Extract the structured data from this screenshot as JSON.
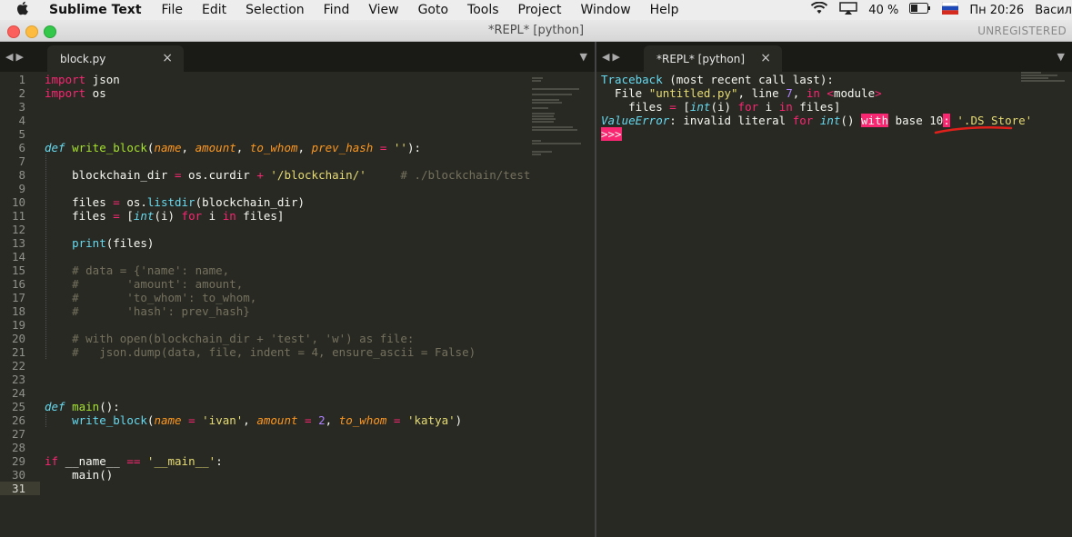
{
  "menubar": {
    "app": "Sublime Text",
    "menus": [
      "File",
      "Edit",
      "Selection",
      "Find",
      "View",
      "Goto",
      "Tools",
      "Project",
      "Window",
      "Help"
    ],
    "battery": "40 %",
    "clock": "Пн 20:26",
    "user": "Васил"
  },
  "window": {
    "title": "*REPL* [python]",
    "unregistered": "UNREGISTERED"
  },
  "left_tab": "block.py",
  "right_tab": "*REPL* [python]",
  "close_glyph": "×",
  "colors": {
    "keyword": "#f92672",
    "function": "#a6e22e",
    "builtin": "#66d9ef",
    "parameter": "#fd971f",
    "string": "#e6db74",
    "number": "#ae81ff",
    "comment": "#75715e",
    "background": "#282923",
    "annotation": "#e0201a"
  },
  "lines": [
    [
      [
        "import",
        "kw"
      ],
      [
        " json",
        ""
      ]
    ],
    [
      [
        "import",
        "kw"
      ],
      [
        " os",
        ""
      ]
    ],
    [],
    [],
    [],
    [
      [
        "def",
        "bii"
      ],
      [
        " ",
        ""
      ],
      [
        "write_block",
        "fn"
      ],
      [
        "(",
        ""
      ],
      [
        "name",
        "pa"
      ],
      [
        ", ",
        ""
      ],
      [
        "amount",
        "pa"
      ],
      [
        ", ",
        ""
      ],
      [
        "to_whom",
        "pa"
      ],
      [
        ", ",
        ""
      ],
      [
        "prev_hash",
        "pa"
      ],
      [
        " ",
        ""
      ],
      [
        "=",
        "op"
      ],
      [
        " ",
        ""
      ],
      [
        "''",
        "st"
      ],
      [
        "):",
        ""
      ]
    ],
    [],
    [
      [
        "    blockchain_dir ",
        ""
      ],
      [
        "=",
        "op"
      ],
      [
        " os.curdir ",
        ""
      ],
      [
        "+",
        "op"
      ],
      [
        " ",
        ""
      ],
      [
        "'/blockchain/'",
        "st"
      ],
      [
        "     ",
        ""
      ],
      [
        "# ./blockchain/test",
        "cm"
      ]
    ],
    [],
    [
      [
        "    files ",
        ""
      ],
      [
        "=",
        "op"
      ],
      [
        " os.",
        ""
      ],
      [
        "listdir",
        "bi"
      ],
      [
        "(blockchain_dir)",
        ""
      ]
    ],
    [
      [
        "    files ",
        ""
      ],
      [
        "=",
        "op"
      ],
      [
        " [",
        ""
      ],
      [
        "int",
        "bii"
      ],
      [
        "(i) ",
        ""
      ],
      [
        "for",
        "kw"
      ],
      [
        " i ",
        ""
      ],
      [
        "in",
        "kw"
      ],
      [
        " files]",
        ""
      ]
    ],
    [],
    [
      [
        "    ",
        ""
      ],
      [
        "print",
        "bi"
      ],
      [
        "(files)",
        ""
      ]
    ],
    [],
    [
      [
        "    # data = {'name': name,",
        "cm"
      ]
    ],
    [
      [
        "    #       'amount': amount,",
        "cm"
      ]
    ],
    [
      [
        "    #       'to_whom': to_whom,",
        "cm"
      ]
    ],
    [
      [
        "    #       'hash': prev_hash}",
        "cm"
      ]
    ],
    [],
    [
      [
        "    # with open(blockchain_dir + 'test', 'w') as file:",
        "cm"
      ]
    ],
    [
      [
        "    #   json.dump(data, file, indent = 4, ensure_ascii = False)",
        "cm"
      ]
    ],
    [],
    [],
    [],
    [
      [
        "def",
        "bii"
      ],
      [
        " ",
        ""
      ],
      [
        "main",
        "fn"
      ],
      [
        "():",
        ""
      ]
    ],
    [
      [
        "    ",
        ""
      ],
      [
        "write_block",
        "bi"
      ],
      [
        "(",
        ""
      ],
      [
        "name",
        "pa"
      ],
      [
        " ",
        ""
      ],
      [
        "=",
        "op"
      ],
      [
        " ",
        ""
      ],
      [
        "'ivan'",
        "st"
      ],
      [
        ", ",
        ""
      ],
      [
        "amount",
        "pa"
      ],
      [
        " ",
        ""
      ],
      [
        "=",
        "op"
      ],
      [
        " ",
        ""
      ],
      [
        "2",
        "nu"
      ],
      [
        ", ",
        ""
      ],
      [
        "to_whom",
        "pa"
      ],
      [
        " ",
        ""
      ],
      [
        "=",
        "op"
      ],
      [
        " ",
        ""
      ],
      [
        "'katya'",
        "st"
      ],
      [
        ")",
        ""
      ]
    ],
    [],
    [],
    [
      [
        "if",
        "kw"
      ],
      [
        " __name__ ",
        ""
      ],
      [
        "==",
        "op"
      ],
      [
        " ",
        ""
      ],
      [
        "'__main__'",
        "st"
      ],
      [
        ":",
        ""
      ]
    ],
    [
      [
        "    main()",
        ""
      ]
    ],
    []
  ],
  "repl_lines": [
    [
      [
        "Traceback",
        "bi"
      ],
      [
        " (most recent call last):",
        ""
      ]
    ],
    [
      [
        "  File ",
        ""
      ],
      [
        "\"untitled.py\"",
        "st"
      ],
      [
        ", line ",
        ""
      ],
      [
        "7",
        "nu"
      ],
      [
        ", ",
        ""
      ],
      [
        "in",
        "kw"
      ],
      [
        " ",
        ""
      ],
      [
        "<",
        "op"
      ],
      [
        "module",
        ""
      ],
      [
        ">",
        "op"
      ]
    ],
    [
      [
        "    files ",
        ""
      ],
      [
        "=",
        "op"
      ],
      [
        " [",
        ""
      ],
      [
        "int",
        "bii"
      ],
      [
        "(i) ",
        ""
      ],
      [
        "for",
        "kw"
      ],
      [
        " i ",
        ""
      ],
      [
        "in",
        "kw"
      ],
      [
        " files]",
        ""
      ]
    ],
    [
      [
        "ValueError",
        "bii"
      ],
      [
        ": invalid literal ",
        ""
      ],
      [
        "for",
        "kw"
      ],
      [
        " ",
        ""
      ],
      [
        "int",
        "bii"
      ],
      [
        "() ",
        ""
      ],
      [
        "with",
        "hl"
      ],
      [
        " base 10",
        ""
      ],
      [
        ":",
        "hl"
      ],
      [
        " ",
        ""
      ],
      [
        "'.DS_Store'",
        "st"
      ]
    ],
    [
      [
        ">>>",
        "hl"
      ]
    ]
  ]
}
